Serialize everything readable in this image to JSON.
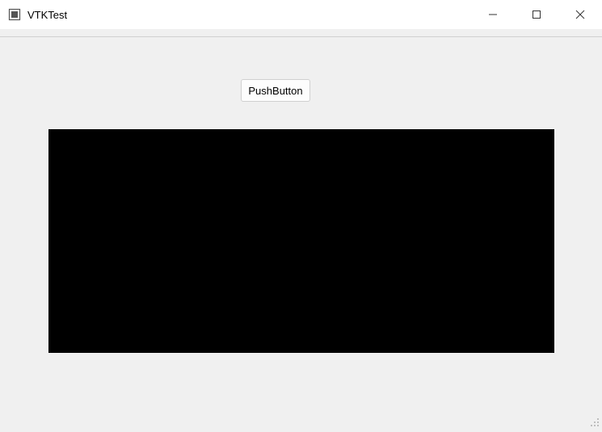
{
  "window": {
    "title": "VTKTest"
  },
  "content": {
    "button_label": "PushButton"
  }
}
